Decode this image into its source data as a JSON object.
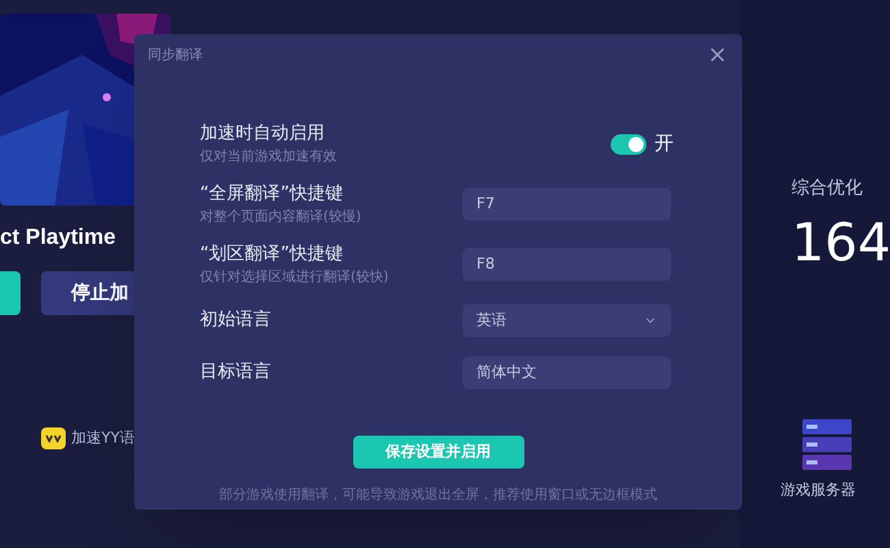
{
  "background": {
    "game_title": "ct Playtime",
    "stop_button": "停止加",
    "voice_label": "加速YY语",
    "score_label": "综合优化",
    "score": "164",
    "server_label": "游戏服务器"
  },
  "dialog": {
    "title": "同步翻译",
    "settings": [
      {
        "kind": "toggle",
        "label": "加速时自动启用",
        "hint": "仅对当前游戏加速有效",
        "on": true,
        "state_label": "开"
      },
      {
        "kind": "hotkey",
        "label": "“全屏翻译”快捷键",
        "hint": "对整个页面内容翻译(较慢)",
        "value": "F7"
      },
      {
        "kind": "hotkey",
        "label": "“划区翻译”快捷键",
        "hint": "仅针对选择区域进行翻译(较快)",
        "value": "F8"
      },
      {
        "kind": "select",
        "label": "初始语言",
        "value": "英语"
      },
      {
        "kind": "text",
        "label": "目标语言",
        "value": "简体中文"
      }
    ],
    "save_button": "保存设置并启用",
    "footer": "部分游戏使用翻译，可能导致游戏退出全屏，推荐使用窗口或无边框模式"
  }
}
